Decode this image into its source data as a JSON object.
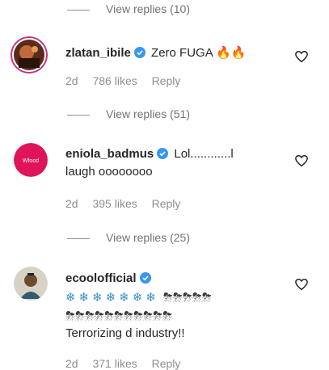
{
  "comments": [
    {
      "username": "zlatan_ibile",
      "text": "Zero FUGA",
      "emojis": "🔥🔥",
      "age": "2d",
      "likes": "786 likes",
      "reply_label": "Reply",
      "view_replies": "View replies (51)"
    },
    {
      "username": "eniola_badmus",
      "text_line1": "Lol............l",
      "text_line2": "laugh oooooooo",
      "age": "2d",
      "likes": "395 likes",
      "reply_label": "Reply",
      "view_replies": "View replies (25)"
    },
    {
      "username": "ecoolofficial",
      "snow_emojis": "❄❄❄❄❄❄❄",
      "storm_emojis_line1": "⛈⛈⛈⛈⛈",
      "storm_emojis_line2": "⛈⛈⛈⛈⛈⛈⛈⛈⛈⛈⛈",
      "text": "Terrorizing d industry!!",
      "age": "2d",
      "likes": "371 likes",
      "reply_label": "Reply"
    }
  ],
  "top_view_replies": "View replies (10)",
  "colors": {
    "verified": "#3897f0",
    "muted": "#8e8e8e",
    "text": "#262626"
  }
}
